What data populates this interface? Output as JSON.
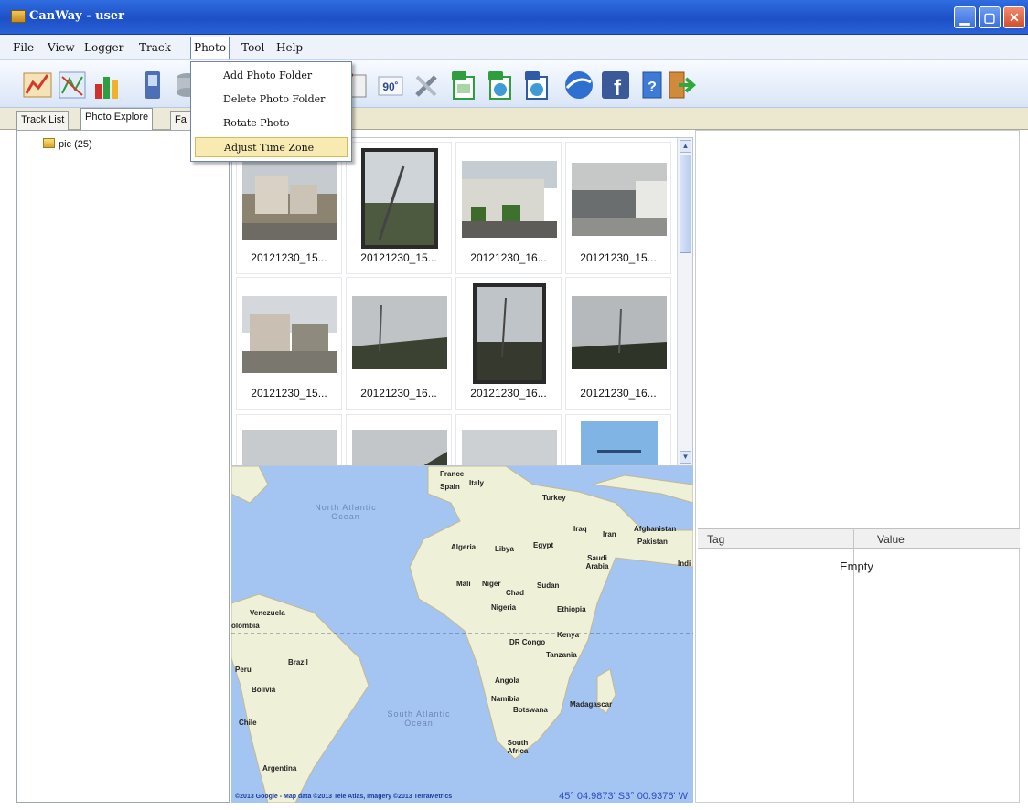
{
  "window": {
    "title": "CanWay - user"
  },
  "menu": [
    "File",
    "View",
    "Logger",
    "Track",
    "Photo",
    "Tool",
    "Help"
  ],
  "photo_menu": [
    "Add Photo Folder",
    "Delete Photo Folder",
    "Rotate Photo",
    "Adjust Time Zone"
  ],
  "tabs": [
    "Track List",
    "Photo Explore",
    "Fa"
  ],
  "tree": {
    "folder": "pic (25)"
  },
  "thumbnails": [
    "20121230_15...",
    "20121230_15...",
    "20121230_16...",
    "20121230_15...",
    "20121230_15...",
    "20121230_16...",
    "20121230_16...",
    "20121230_16..."
  ],
  "map": {
    "labels": {
      "france": "France",
      "spain": "Spain",
      "italy": "Italy",
      "turkey": "Turkey",
      "iraq": "Iraq",
      "iran": "Iran",
      "afghanistan": "Afghanistan",
      "pakistan": "Pakistan",
      "india": "Indi",
      "algeria": "Algeria",
      "libya": "Libya",
      "egypt": "Egypt",
      "saudi": "Saudi Arabia",
      "mali": "Mali",
      "niger": "Niger",
      "chad": "Chad",
      "sudan": "Sudan",
      "nigeria": "Nigeria",
      "ethiopia": "Ethiopia",
      "venezuela": "Venezuela",
      "colombia": "olombia",
      "kenya": "Kenya",
      "drc": "DR Congo",
      "tanzania": "Tanzania",
      "peru": "Peru",
      "brazil": "Brazil",
      "bolivia": "Bolivia",
      "angola": "Angola",
      "namibia": "Namibia",
      "botswana": "Botswana",
      "madagascar": "Madagascar",
      "chile": "Chile",
      "south_africa": "South Africa",
      "argentina": "Argentina"
    },
    "oceans": {
      "north_atlantic": "North Atlantic Ocean",
      "south_atlantic": "South Atlantic Ocean"
    },
    "attribution": "©2013 Google - Map data ©2013 Tele Atlas, Imagery ©2013 TerraMetrics",
    "coordinates": "45° 04.9873' S3° 00.9376' W"
  },
  "grid": {
    "col_tag": "Tag",
    "col_value": "Value",
    "empty": "Empty"
  }
}
